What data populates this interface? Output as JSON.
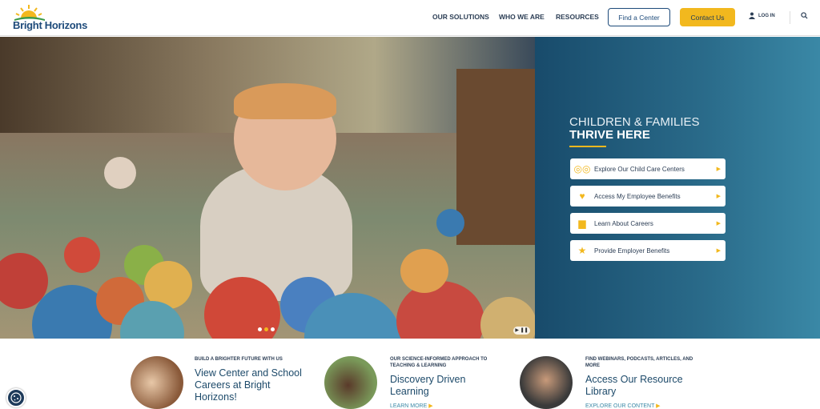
{
  "header": {
    "logo_text": "Bright Horizons",
    "nav": [
      "OUR SOLUTIONS",
      "WHO WE ARE",
      "RESOURCES"
    ],
    "find_center": "Find a Center",
    "contact_us": "Contact Us",
    "login": "LOG IN",
    "icons": {
      "user": "user-icon",
      "search": "search-icon"
    }
  },
  "hero": {
    "line1": "CHILDREN & FAMILIES",
    "line2": "THRIVE HERE",
    "accent": "#f2b81e",
    "carousel_slides": 3,
    "active_slide": 2,
    "ctas": [
      {
        "label": "Explore Our Child Care Centers",
        "icon": "binoculars-icon"
      },
      {
        "label": "Access My Employee Benefits",
        "icon": "heart-icon"
      },
      {
        "label": "Learn About Careers",
        "icon": "building-icon"
      },
      {
        "label": "Provide Employer Benefits",
        "icon": "star-icon"
      }
    ]
  },
  "cards": [
    {
      "eyebrow": "BUILD A BRIGHTER FUTURE WITH US",
      "title": "View Center and School Careers at Bright Horizons!",
      "link": ""
    },
    {
      "eyebrow": "OUR SCIENCE-INFORMED APPROACH TO TEACHING & LEARNING",
      "title": "Discovery Driven Learning",
      "link": "LEARN MORE"
    },
    {
      "eyebrow": "FIND WEBINARS, PODCASTS, ARTICLES, AND MORE",
      "title": "Access Our Resource Library",
      "link": "EXPLORE OUR CONTENT"
    }
  ]
}
